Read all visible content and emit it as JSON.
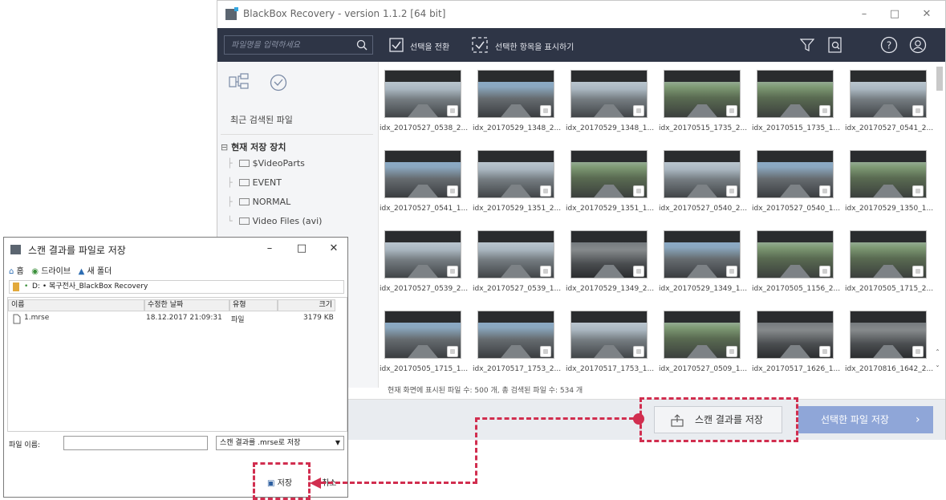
{
  "main_window": {
    "title": "BlackBox Recovery - version 1.1.2 [64 bit]",
    "toolbar": {
      "search_placeholder": "파일명을 입력하세요",
      "toggle_selection_label": "선택을 전환",
      "show_selected_label": "선택한 항목을 표시하기"
    },
    "sidebar": {
      "recent_files": "최근 검색된 파일",
      "device_root": "현재 저장 장치",
      "folders": [
        "$VideoParts",
        "EVENT",
        "NORMAL",
        "Video Files (avi)"
      ]
    },
    "thumbnails": [
      "idx_20170527_0538_2...",
      "idx_20170529_1348_2...",
      "idx_20170529_1348_1...",
      "idx_20170515_1735_2...",
      "idx_20170515_1735_1...",
      "idx_20170527_0541_2...",
      "idx_20170527_0541_1...",
      "idx_20170529_1351_2...",
      "idx_20170529_1351_1...",
      "idx_20170527_0540_2...",
      "idx_20170527_0540_1...",
      "idx_20170529_1350_1...",
      "idx_20170527_0539_2...",
      "idx_20170527_0539_1...",
      "idx_20170529_1349_2...",
      "idx_20170529_1349_1...",
      "idx_20170505_1156_2...",
      "idx_20170505_1715_2...",
      "idx_20170505_1715_1...",
      "idx_20170517_1753_2...",
      "idx_20170517_1753_1...",
      "idx_20170527_0509_1...",
      "idx_20170517_1626_1...",
      "idx_20170816_1642_2..."
    ],
    "status": "현재 화면에 표시된 파일 수: 500 개,  총 검색된 파일 수: 534 개",
    "save_scan_button": "스캔 결과를 저장",
    "save_selected_button": "선택한 파일 저장"
  },
  "dialog": {
    "title": "스캔 결과를 파일로 저장",
    "nav": {
      "home": "홈",
      "drive": "드라이브",
      "new_folder": "새 폴더"
    },
    "path": "D:  •  복구전사_BlackBox Recovery",
    "columns": [
      "이름",
      "수정한 날짜",
      "유형",
      "크기"
    ],
    "files": [
      {
        "name": "1.mrse",
        "modified": "18.12.2017 21:09:31",
        "type": "파일",
        "size": "3179 KB"
      }
    ],
    "filename_label": "파일 이름:",
    "filename_value": "",
    "file_type": "스캔 결과를 .mrse로 저장",
    "save_button": "저장",
    "cancel_button": "취소"
  },
  "colors": {
    "toolbar_bg": "#2e3546",
    "accent_button": "#8fa6d8",
    "annotation": "#d12e4f"
  }
}
